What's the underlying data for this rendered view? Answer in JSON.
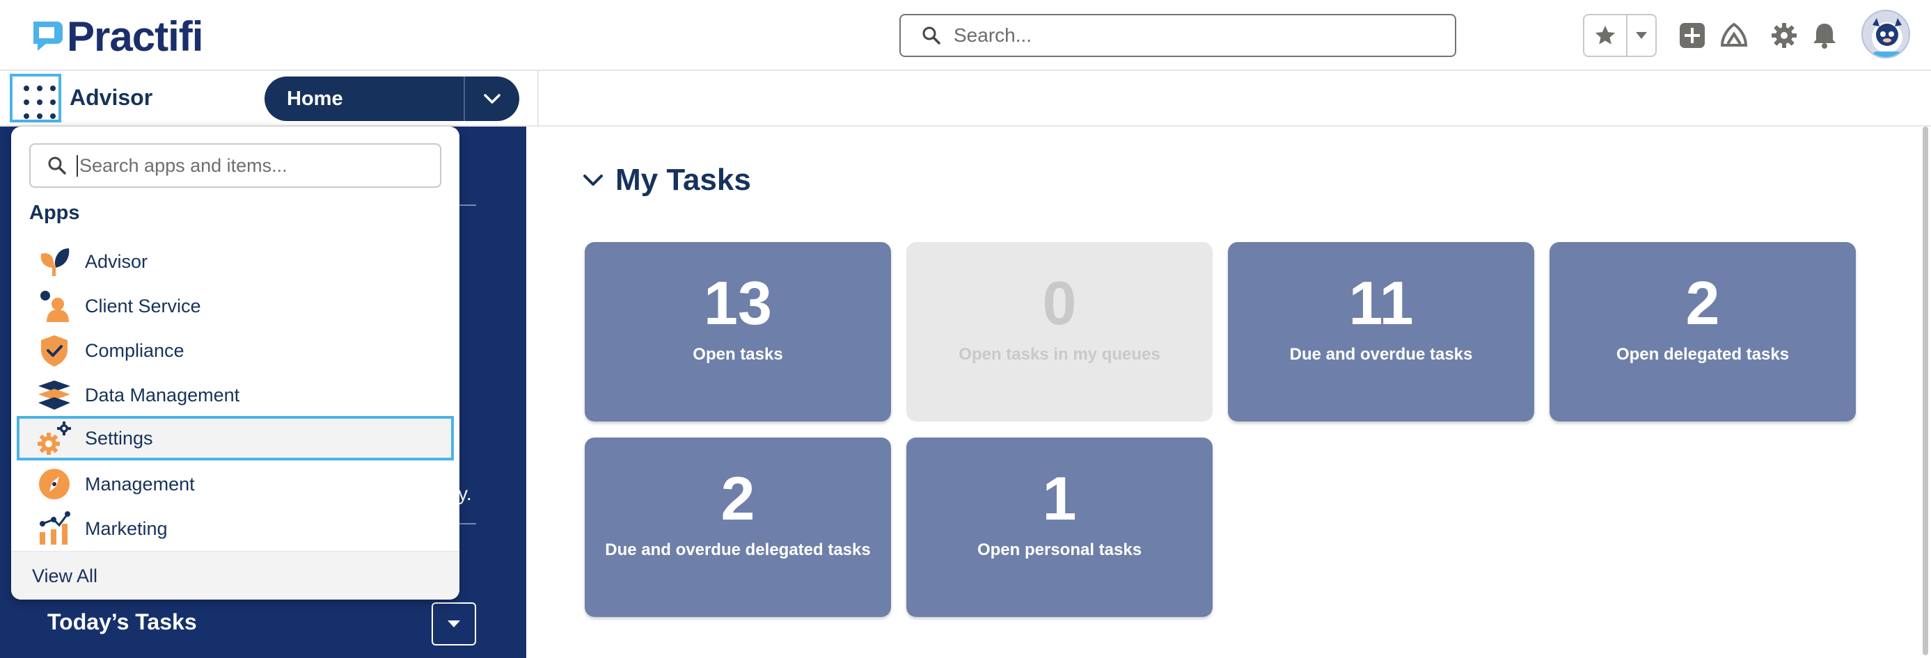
{
  "header": {
    "brand": "Practifi",
    "search_placeholder": "Search..."
  },
  "nav": {
    "app_name": "Advisor",
    "current_tab": "Home"
  },
  "left_panel": {
    "fragment_text": "y.",
    "todays_tasks_label": "Today’s Tasks"
  },
  "app_launcher": {
    "search_placeholder": "Search apps and items...",
    "apps_title": "Apps",
    "items": [
      {
        "label": "Advisor",
        "icon": "advisor-icon"
      },
      {
        "label": "Client Service",
        "icon": "client-service-icon"
      },
      {
        "label": "Compliance",
        "icon": "compliance-icon"
      },
      {
        "label": "Data Management",
        "icon": "data-management-icon"
      },
      {
        "label": "Settings",
        "icon": "settings-icon"
      },
      {
        "label": "Management",
        "icon": "management-icon"
      },
      {
        "label": "Marketing",
        "icon": "marketing-icon"
      }
    ],
    "view_all": "View All"
  },
  "main": {
    "section_title": "My Tasks",
    "tiles": [
      {
        "value": "13",
        "label": "Open tasks"
      },
      {
        "value": "0",
        "label": "Open tasks in my queues"
      },
      {
        "value": "11",
        "label": "Due and overdue tasks"
      },
      {
        "value": "2",
        "label": "Open delegated tasks"
      },
      {
        "value": "2",
        "label": "Due and overdue delegated tasks"
      },
      {
        "value": "1",
        "label": "Open personal tasks"
      }
    ]
  },
  "colors": {
    "navy": "#16325c",
    "panel_navy": "#16306b",
    "tile_blue": "#6e80a9",
    "focus_blue": "#4bb3e8",
    "orange": "#f39a4a"
  }
}
